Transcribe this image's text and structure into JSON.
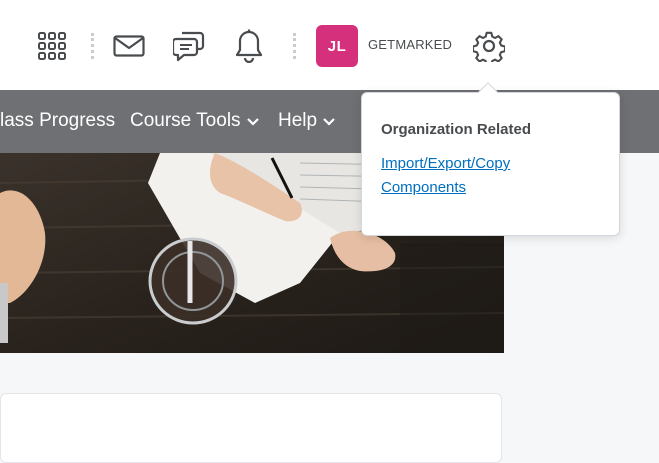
{
  "header": {
    "icons": [
      "apps-grid-icon",
      "mail-icon",
      "chat-icon",
      "bell-icon",
      "gear-icon"
    ],
    "user_initials": "JL",
    "org_name": "GETMARKED",
    "avatar_color": "#d5307b"
  },
  "navbar": {
    "items": [
      {
        "label": "lass Progress",
        "has_dropdown": false
      },
      {
        "label": "Course Tools",
        "has_dropdown": true
      },
      {
        "label": "Help",
        "has_dropdown": true
      }
    ],
    "background": "#6e7073"
  },
  "settings_popover": {
    "heading": "Organization Related",
    "link_label": "Import/Export/Copy Components",
    "link_color": "#006fbf"
  },
  "hero": {
    "image": "desk-with-notebook-and-coffee-photo"
  }
}
